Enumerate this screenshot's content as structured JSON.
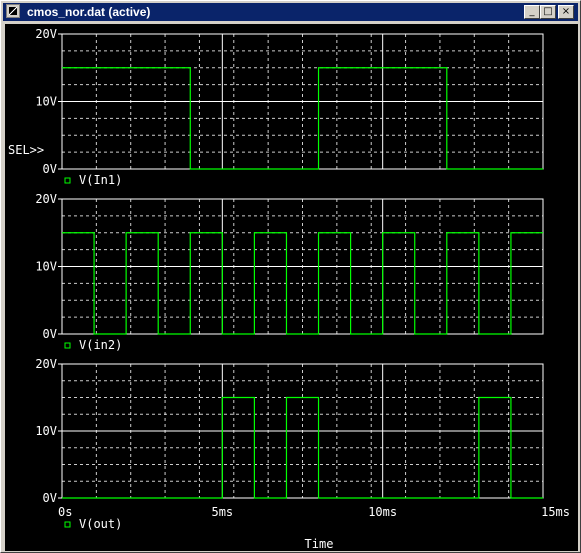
{
  "window": {
    "title": "cmos_nor.dat (active)",
    "buttons": {
      "minimize": "_",
      "maximize": "□",
      "close": "×"
    }
  },
  "plot": {
    "sel_marker": "SEL>>",
    "y_ticks": [
      "20V",
      "10V",
      "0V"
    ],
    "x_ticks": [
      "0s",
      "5ms",
      "10ms",
      "15ms"
    ],
    "x_label": "Time",
    "colors": {
      "trace": "#00ff00",
      "grid": "#ffffff",
      "text": "#ffffff",
      "background": "#000000",
      "legend_marker": "#00ff00"
    }
  },
  "chart_data": [
    {
      "type": "line",
      "series": [
        {
          "name": "V(In1)",
          "x": [
            0,
            4,
            4,
            8,
            8,
            12,
            12,
            15
          ],
          "y": [
            15,
            15,
            0,
            0,
            15,
            15,
            0,
            0
          ]
        }
      ],
      "ylim": [
        0,
        20
      ],
      "xlim": [
        0,
        15
      ],
      "x_unit": "ms",
      "y_unit": "V",
      "grid": true
    },
    {
      "type": "line",
      "series": [
        {
          "name": "V(in2)",
          "x": [
            0,
            1,
            1,
            2,
            2,
            3,
            3,
            4,
            4,
            5,
            5,
            6,
            6,
            7,
            7,
            8,
            8,
            9,
            9,
            10,
            10,
            11,
            11,
            12,
            12,
            13,
            13,
            14,
            14,
            15
          ],
          "y": [
            15,
            15,
            0,
            0,
            15,
            15,
            0,
            0,
            15,
            15,
            0,
            0,
            15,
            15,
            0,
            0,
            15,
            15,
            0,
            0,
            15,
            15,
            0,
            0,
            15,
            15,
            0,
            0,
            15,
            15
          ]
        }
      ],
      "ylim": [
        0,
        20
      ],
      "xlim": [
        0,
        15
      ],
      "x_unit": "ms",
      "y_unit": "V",
      "grid": true
    },
    {
      "type": "line",
      "series": [
        {
          "name": "V(out)",
          "x": [
            0,
            5,
            5,
            6,
            6,
            7,
            7,
            8,
            8,
            13,
            13,
            14,
            14,
            15
          ],
          "y": [
            0,
            0,
            15,
            15,
            0,
            0,
            15,
            15,
            0,
            0,
            15,
            15,
            0,
            0
          ]
        }
      ],
      "ylim": [
        0,
        20
      ],
      "xlim": [
        0,
        15
      ],
      "x_unit": "ms",
      "y_unit": "V",
      "grid": true
    }
  ]
}
